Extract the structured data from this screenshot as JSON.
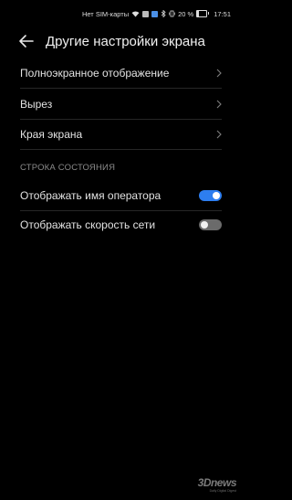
{
  "status_bar": {
    "carrier": "Нет SIM-карты",
    "battery_percent": "20 %",
    "time": "17:51",
    "icons": [
      "wifi-icon",
      "notification-icon",
      "notification-icon",
      "bluetooth-icon",
      "vibrate-icon",
      "battery-icon"
    ]
  },
  "header": {
    "back_icon": "arrow-left-icon",
    "title": "Другие настройки экрана"
  },
  "menu_items": [
    {
      "label": "Полноэкранное отображение",
      "icon": "chevron-right-icon"
    },
    {
      "label": "Вырез",
      "icon": "chevron-right-icon"
    },
    {
      "label": "Края экрана",
      "icon": "chevron-right-icon"
    }
  ],
  "status_section": {
    "title": "СТРОКА СОСТОЯНИЯ",
    "toggles": [
      {
        "label": "Отображать имя оператора",
        "on": true
      },
      {
        "label": "Отображать скорость сети",
        "on": false
      }
    ]
  },
  "colors": {
    "background": "#000000",
    "accent": "#2d7ef0",
    "toggle_off": "#6b6b6b"
  },
  "watermark": {
    "logo": "3Dnews",
    "tagline": "Daily Digital Digest"
  }
}
